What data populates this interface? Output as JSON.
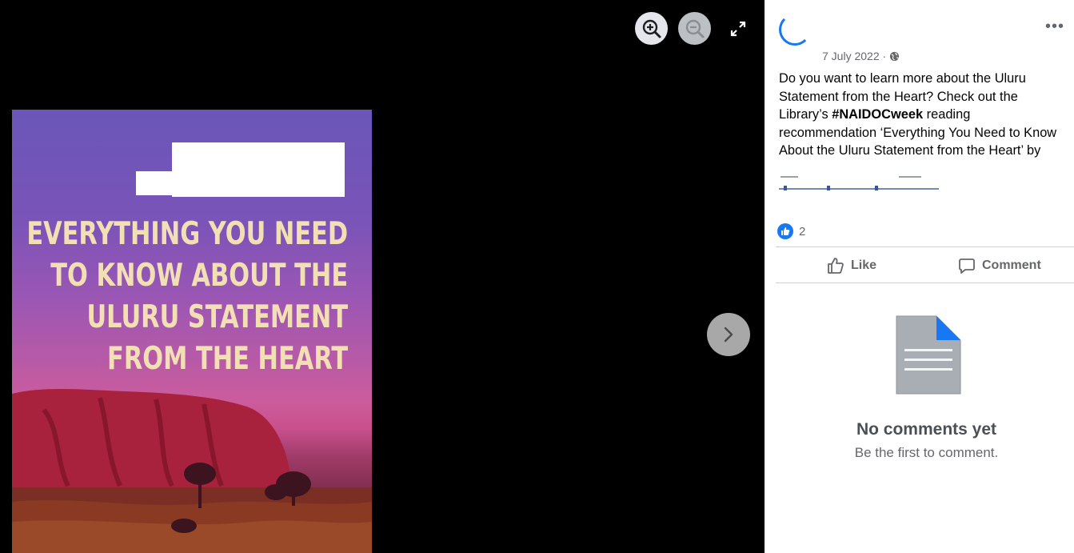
{
  "viewer": {
    "controls": {
      "zoom_in_icon": "zoom-in-icon",
      "zoom_out_icon": "zoom-out-icon",
      "fullscreen_icon": "expand-icon",
      "next_icon": "chevron-right-icon"
    },
    "cover": {
      "title_lines": [
        "EVERYTHING YOU NEED",
        "TO KNOW ABOUT THE",
        "ULURU STATEMENT",
        "FROM THE HEART"
      ]
    }
  },
  "post": {
    "date": "7 July 2022 ·",
    "text_before_hashtag": "Do you want to learn more about the Uluru Statement from the Heart? Check out the Library’s ",
    "hashtag": "#NAIDOCweek",
    "text_after_hashtag": " reading recommendation ‘Everything You Need to Know About the Uluru Statement from the Heart’ by",
    "reaction_count": "2"
  },
  "actions": {
    "like_label": "Like",
    "comment_label": "Comment"
  },
  "comments": {
    "empty_title": "No comments yet",
    "empty_subtitle": "Be the first to comment."
  },
  "colors": {
    "accent": "#1877f2",
    "panel_bg": "#ffffff",
    "viewer_bg": "#000000",
    "cover_text": "#f2dfb4"
  }
}
